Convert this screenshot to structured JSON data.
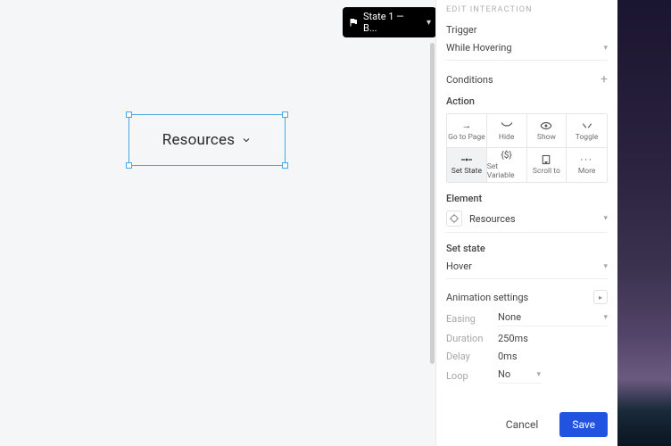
{
  "canvas": {
    "statePill": "State 1 — B...",
    "widgetLabel": "Resources"
  },
  "panel": {
    "header": "EDIT INTERACTION",
    "trigger": {
      "label": "Trigger",
      "value": "While Hovering"
    },
    "conditions": {
      "label": "Conditions"
    },
    "action": {
      "label": "Action",
      "tiles": [
        {
          "label": "Go to Page",
          "icon": "arrow-right"
        },
        {
          "label": "Hide",
          "icon": "eye-closed"
        },
        {
          "label": "Show",
          "icon": "eye"
        },
        {
          "label": "Toggle",
          "icon": "toggle"
        },
        {
          "label": "Set State",
          "icon": "set-state",
          "active": true
        },
        {
          "label": "Set Variable",
          "icon": "variable"
        },
        {
          "label": "Scroll to",
          "icon": "scroll"
        },
        {
          "label": "More",
          "icon": "more"
        }
      ]
    },
    "element": {
      "label": "Element",
      "value": "Resources"
    },
    "setState": {
      "label": "Set state",
      "value": "Hover"
    },
    "animation": {
      "label": "Animation settings",
      "easing": {
        "label": "Easing",
        "value": "None"
      },
      "duration": {
        "label": "Duration",
        "value": "250ms"
      },
      "delay": {
        "label": "Delay",
        "value": "0ms"
      },
      "loop": {
        "label": "Loop",
        "value": "No"
      }
    },
    "footer": {
      "cancel": "Cancel",
      "save": "Save"
    }
  }
}
